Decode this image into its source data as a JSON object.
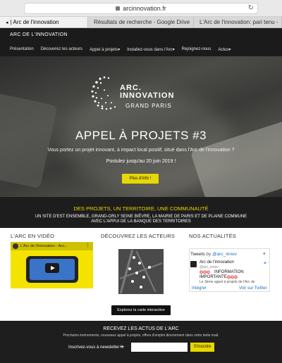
{
  "browser": {
    "url": "arcinnovation.fr",
    "tabs": [
      {
        "label": "| Arc de l'innovation",
        "active": true
      },
      {
        "label": "Résultats de recherche - Google Drive",
        "active": false
      },
      {
        "label": "L'Arc de l'innovation: pari tenu -",
        "active": false
      }
    ]
  },
  "site": {
    "brand": "ARC DE L'INNOVATION",
    "nav": [
      "Présentation",
      "Découvrez les acteurs",
      "Appel à projets▾",
      "Installez-vous dans l'Arc▾",
      "Rejoignez-nous",
      "Actus▾"
    ]
  },
  "hero": {
    "logo_line1": "ARC.",
    "logo_line2": "INNOVATION",
    "logo_line3": "GRAND PARIS",
    "title": "APPEL À PROJETS #3",
    "subtitle": "Vous portez un projet innovant, à impact local positif, situé dans l'Arc de l'innovation ?",
    "deadline": "Postulez jusqu'au 20 juin 2019 !",
    "button": "Plus d'info !"
  },
  "band": {
    "title": "DES PROJETS, UN TERRITOIRE, UNE COMMUNAUTÉ",
    "line1": "UN SITE D'EST ENSEMBLE, GRAND-ORLY SEINE BIÈVRE, LA MAIRIE DE PARIS ET DE PLAINE COMMUNE",
    "line2": "AVEC L'APPUI DE LA BANQUE DES TERRITOIRES"
  },
  "columns": {
    "video_heading": "L'ARC EN VIDÉO",
    "video_title": "L'Arc de l'innovation - Acc...",
    "actors_heading": "DÉCOUVREZ LES ACTEURS",
    "actors_button": "Explorez la carte interactive",
    "news_heading": "NOS ACTUALITÉS"
  },
  "twitter": {
    "header": "Tweets",
    "by": "by",
    "handle": "@arc_innov",
    "name": "Arc de l'innovation",
    "user_handle": "@arc_innov",
    "stars": "✪✪✪",
    "line1": "INFORMATION",
    "line2": "IMPORTANTE",
    "line3": "Le 3ème appel à projets de l'Arc de",
    "embed": "Intégrer",
    "view": "Voir sur Twitter"
  },
  "newsletter": {
    "title": "RECEVEZ LES ACTUS DE L'ARC",
    "description": "Prochains événements, nouveaux appel à projets, offres d'emploi directement dans votre boite mail.",
    "label": "Inscrivez-vous à newsletter !",
    "placeholder": "",
    "button": "S'inscrire"
  },
  "colors": {
    "accent": "#e8d700",
    "dark": "#1b1b1b"
  }
}
